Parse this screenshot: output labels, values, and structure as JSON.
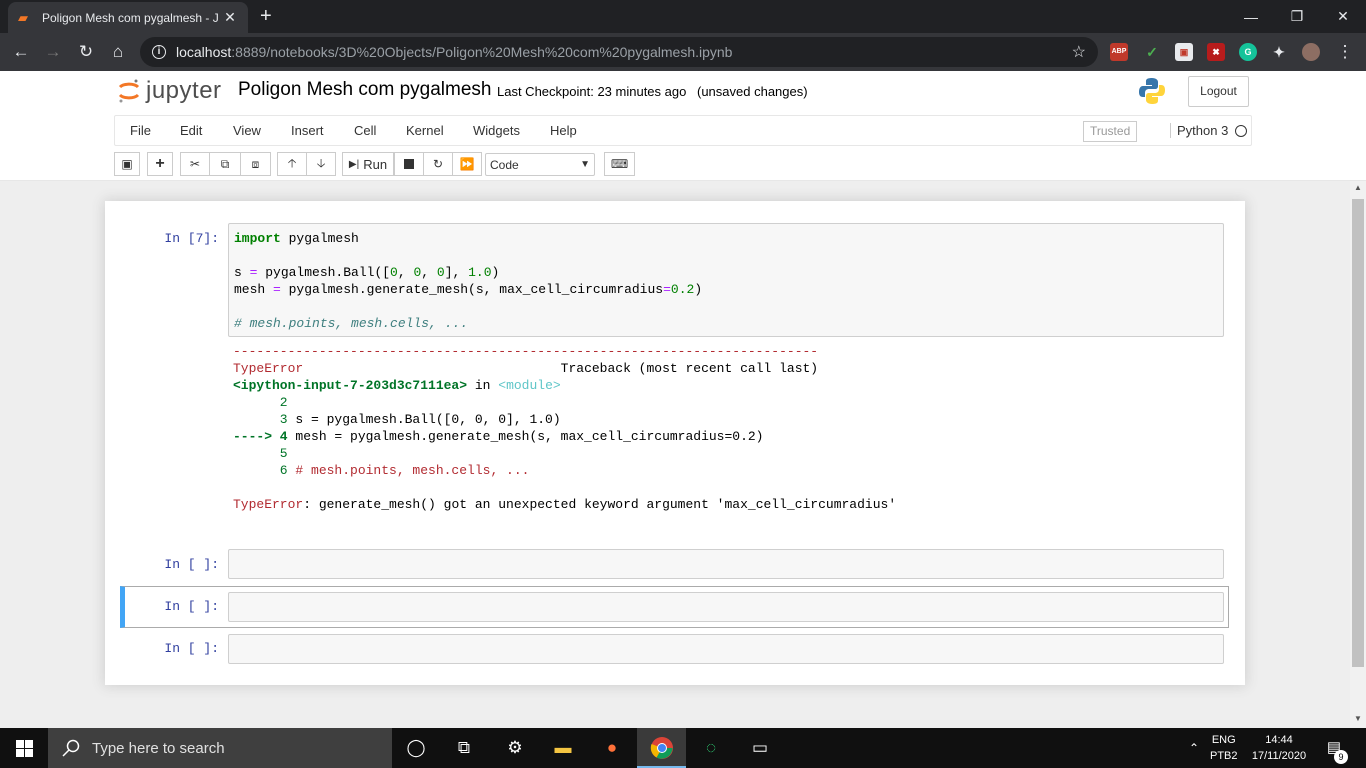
{
  "browser": {
    "tab_title": "Poligon Mesh com pygalmesh - J",
    "close": "✕",
    "new_tab": "+",
    "url_host": "localhost",
    "url_path": ":8889/notebooks/3D%20Objects/Poligon%20Mesh%20com%20pygalmesh.ipynb",
    "extensions": [
      "ABP",
      "✓",
      "▣",
      "✖",
      "G",
      "✦"
    ]
  },
  "jupyter": {
    "logo_text": "jupyter",
    "notebook_title": "Poligon Mesh com pygalmesh",
    "checkpoint": "Last Checkpoint: 23 minutes ago",
    "autosave": "(unsaved changes)",
    "logout": "Logout",
    "menu": [
      "File",
      "Edit",
      "View",
      "Insert",
      "Cell",
      "Kernel",
      "Widgets",
      "Help"
    ],
    "trusted": "Trusted",
    "kernel_name": "Python 3",
    "run_label": "Run",
    "cell_type": "Code"
  },
  "cells": {
    "cell1_prompt": "In [7]:",
    "code": {
      "l1_kw": "import",
      "l1_rest": " pygalmesh",
      "l3a": "s ",
      "l3b": "=",
      "l3c": " pygalmesh.Ball([",
      "l3d": "0",
      "l3e": ", ",
      "l3f": "0",
      "l3g": ", ",
      "l3h": "0",
      "l3i": "], ",
      "l3j": "1.0",
      "l3k": ")",
      "l4a": "mesh ",
      "l4b": "=",
      "l4c": " pygalmesh.generate_mesh(s, max_cell_circumradius",
      "l4d": "=",
      "l4e": "0.2",
      "l4f": ")",
      "l6": "# mesh.points, mesh.cells, ..."
    },
    "traceback": {
      "dashes": "---------------------------------------------------------------------------",
      "err_type": "TypeError",
      "tb_head": "                                 Traceback (most recent call last)",
      "input_ref": "<ipython-input-7-203d3c7111ea>",
      "in_word": " in ",
      "module": "<module>",
      "l2": "      2",
      "l3num": "      3",
      "l3code": " s = pygalmesh.Ball([0, 0, 0], 1.0)",
      "arrow": "----> 4",
      "l4code": " mesh = pygalmesh.generate_mesh(s, max_cell_circumradius=0.2)",
      "l5": "      5",
      "l6num": "      6",
      "l6code": " # mesh.points, mesh.cells, ...",
      "final_type": "TypeError",
      "final_msg": ": generate_mesh() got an unexpected keyword argument 'max_cell_circumradius'"
    },
    "empty_prompt": "In [ ]:"
  },
  "taskbar": {
    "search_placeholder": "Type here to search",
    "lang": "ENG",
    "layout": "PTB2",
    "time": "14:44",
    "date": "17/11/2020",
    "notifications": "9"
  }
}
